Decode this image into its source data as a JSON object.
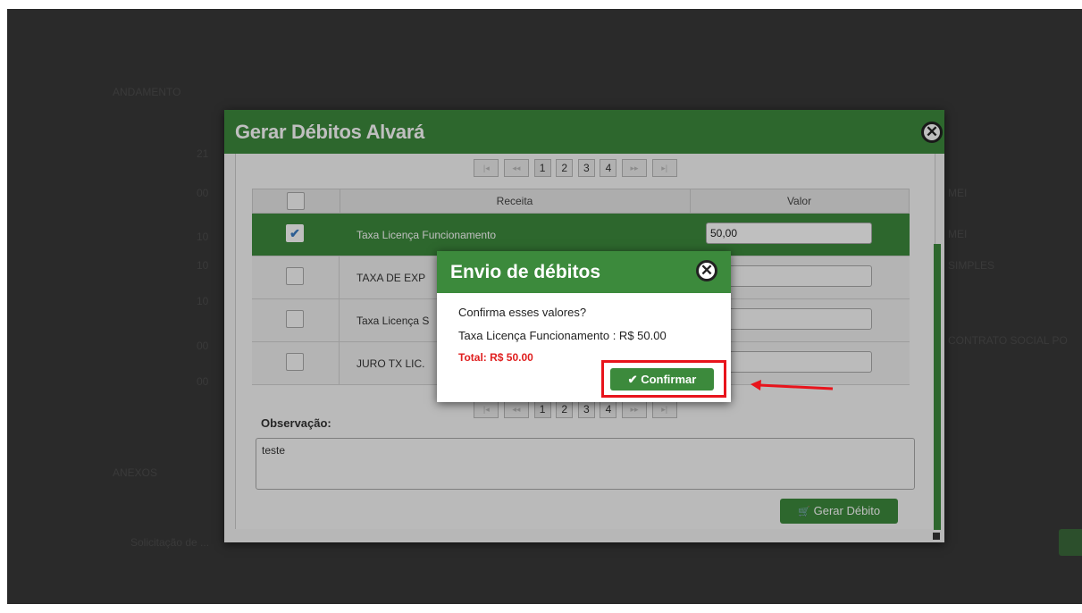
{
  "background": {
    "texts": [
      "ANDAMENTO",
      "21",
      "00",
      "10",
      "10",
      "10",
      "00",
      "00",
      "ANEXOS",
      "Solicitação de ...",
      "MEI",
      "MEI",
      "SIMPLES",
      "CONTRATO SOCIAL PO"
    ]
  },
  "dialog": {
    "title": "Gerar Débitos Alvará",
    "pager": {
      "first": "|◂",
      "prev": "◂◂",
      "pages": [
        "1",
        "2",
        "3",
        "4"
      ],
      "next": "▸▸",
      "last": "▸|"
    },
    "columns": {
      "receita": "Receita",
      "valor": "Valor"
    },
    "rows": [
      {
        "receita": "Taxa Licença Funcionamento",
        "valor": "50,00",
        "checked": true
      },
      {
        "receita": "TAXA DE EXP",
        "valor": "",
        "checked": false
      },
      {
        "receita": "Taxa Licença S",
        "valor": "",
        "checked": false
      },
      {
        "receita": "JURO TX LIC.",
        "valor": "",
        "checked": false
      }
    ],
    "observacao_label": "Observação:",
    "observacao_value": "teste",
    "gerar_button": "Gerar Débito"
  },
  "modal": {
    "title": "Envio de débitos",
    "question": "Confirma esses valores?",
    "item_line": "Taxa Licença Funcionamento : R$ 50.00",
    "total_line": "Total: R$ 50.00",
    "confirm_button": "Confirmar"
  },
  "colors": {
    "header_green": "#3c8a3c",
    "highlight_red": "#e8141c",
    "total_red": "#e02020"
  }
}
